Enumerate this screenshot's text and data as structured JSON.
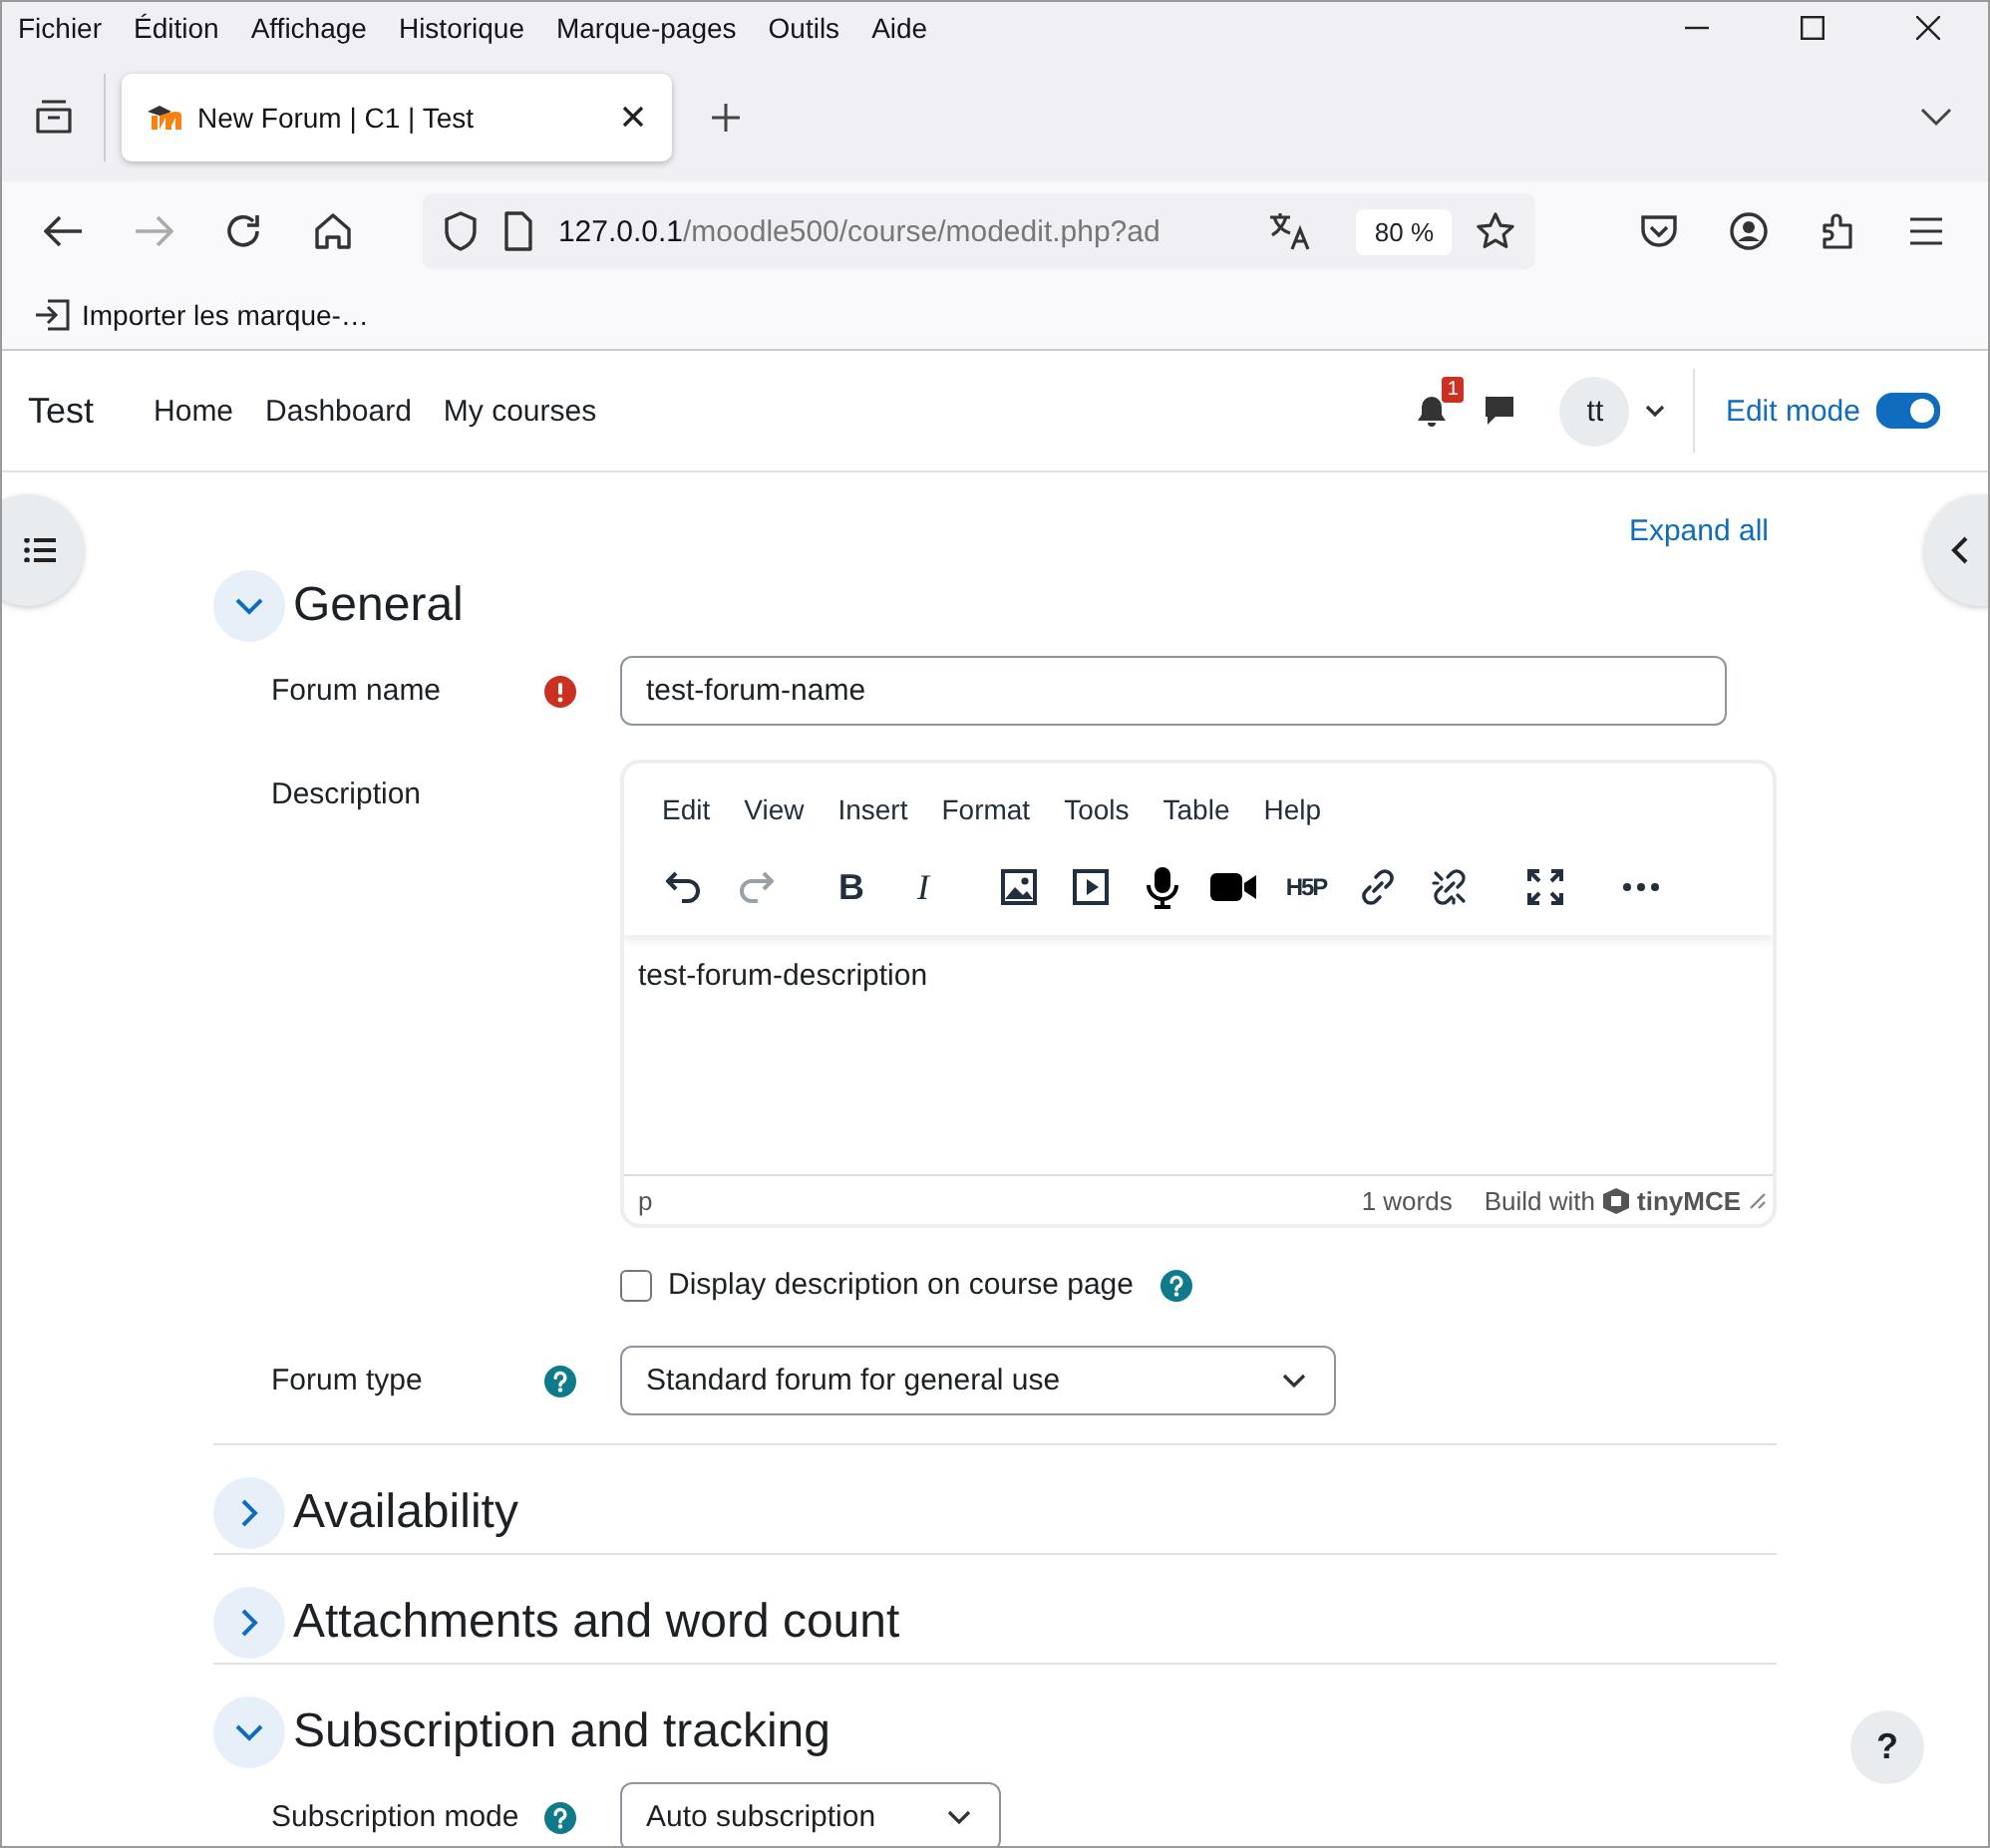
{
  "browser": {
    "menu_bar": [
      {
        "label": "Fichier"
      },
      {
        "label": "Édition"
      },
      {
        "label": "Affichage"
      },
      {
        "label": "Historique"
      },
      {
        "label": "Marque-pages"
      },
      {
        "label": "Outils"
      },
      {
        "label": "Aide"
      }
    ],
    "tab": {
      "title": "New Forum | C1 | Test",
      "selected": true
    },
    "address": {
      "host": "127.0.0.1",
      "path": "/moodle500/course/modedit.php?ad",
      "zoom": "80 %"
    },
    "bookmarks": [
      {
        "label": "Importer les marque-…"
      }
    ]
  },
  "site": {
    "name": "Test",
    "nav": [
      {
        "label": "Home"
      },
      {
        "label": "Dashboard"
      },
      {
        "label": "My courses"
      }
    ],
    "notification_count": "1",
    "avatar": "tt",
    "edit_mode": {
      "label": "Edit mode",
      "on": true
    }
  },
  "expand_all": "Expand all",
  "sections": [
    {
      "title": "General",
      "expanded": true,
      "fields": [
        {
          "kind": "text",
          "label": "Forum name",
          "required": true,
          "help": false,
          "value": "test-forum-name"
        },
        {
          "kind": "editor",
          "label": "Description",
          "required": false,
          "help": false,
          "menu": [
            "Edit",
            "View",
            "Insert",
            "Format",
            "Tools",
            "Table",
            "Help"
          ],
          "toolbar": [
            {
              "buttons": [
                {
                  "kind": "undo",
                  "disabled": false
                },
                {
                  "kind": "redo",
                  "disabled": true
                }
              ]
            },
            {
              "buttons": [
                {
                  "kind": "bold",
                  "glyph": "B",
                  "disabled": false
                },
                {
                  "kind": "italic",
                  "glyph": "I",
                  "disabled": false
                }
              ]
            },
            {
              "buttons": [
                {
                  "kind": "image",
                  "disabled": false
                },
                {
                  "kind": "media",
                  "disabled": false
                },
                {
                  "kind": "microphone",
                  "disabled": false
                },
                {
                  "kind": "camera",
                  "disabled": false
                },
                {
                  "kind": "h5p",
                  "glyph": "H5P",
                  "disabled": false
                },
                {
                  "kind": "link",
                  "disabled": false
                },
                {
                  "kind": "unlink",
                  "disabled": false
                }
              ]
            },
            {
              "buttons": [
                {
                  "kind": "fullscreen",
                  "disabled": false
                }
              ]
            },
            {
              "buttons": [
                {
                  "kind": "more",
                  "disabled": false
                }
              ]
            }
          ],
          "content": "test-forum-description",
          "path": "p",
          "word_count": "1 words",
          "brand_prefix": "Build with",
          "brand": "tinyMCE"
        },
        {
          "kind": "checkbox",
          "label": "Display description on course page",
          "checked": false,
          "help": true
        },
        {
          "kind": "select",
          "label": "Forum type",
          "required": false,
          "help": true,
          "value": "Standard forum for general use"
        }
      ]
    },
    {
      "title": "Availability",
      "expanded": false
    },
    {
      "title": "Attachments and word count",
      "expanded": false
    },
    {
      "title": "Subscription and tracking",
      "expanded": true,
      "fields": [
        {
          "kind": "select",
          "label": "Subscription mode",
          "required": false,
          "help": true,
          "value": "Auto subscription"
        }
      ]
    }
  ],
  "help_button": "?"
}
